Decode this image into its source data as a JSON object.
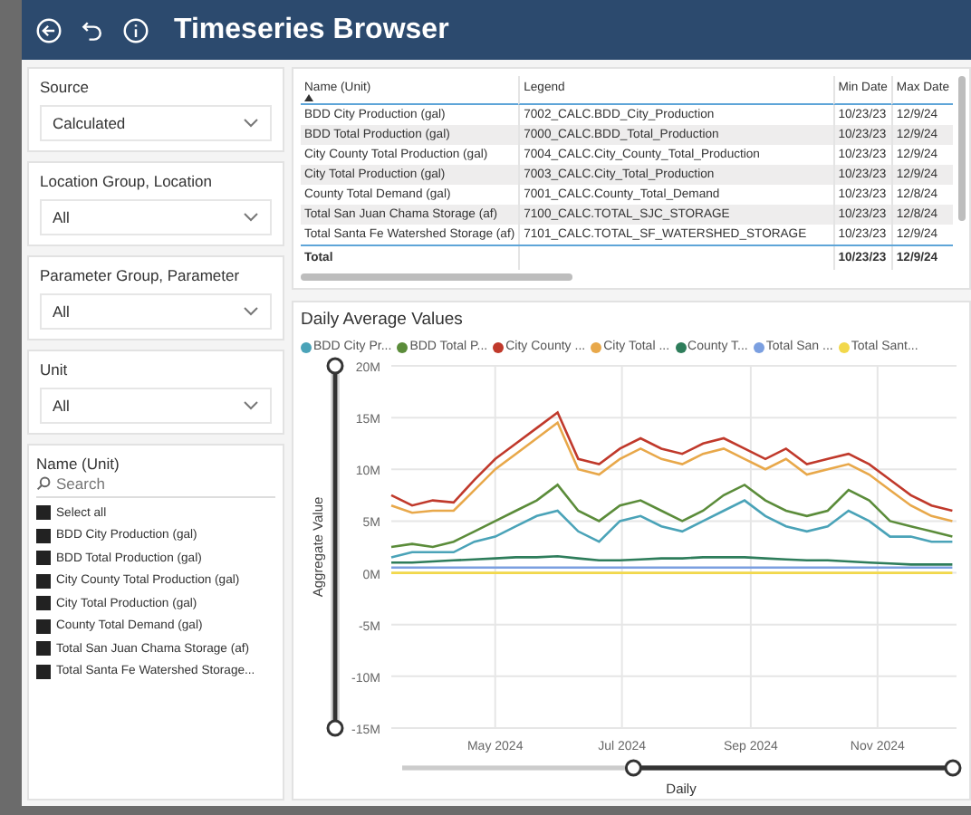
{
  "header": {
    "title": "Timeseries Browser"
  },
  "filters": [
    {
      "label": "Source",
      "value": "Calculated"
    },
    {
      "label": "Location Group, Location",
      "value": "All"
    },
    {
      "label": "Parameter Group, Parameter",
      "value": "All"
    },
    {
      "label": "Unit",
      "value": "All"
    }
  ],
  "name_filter": {
    "label": "Name (Unit)",
    "placeholder": "Search",
    "items": [
      {
        "label": "Select all",
        "checked": true
      },
      {
        "label": "BDD City Production (gal)",
        "checked": true
      },
      {
        "label": "BDD Total Production (gal)",
        "checked": true
      },
      {
        "label": "City County Total Production (gal)",
        "checked": true
      },
      {
        "label": "City Total Production (gal)",
        "checked": true
      },
      {
        "label": "County Total Demand (gal)",
        "checked": true
      },
      {
        "label": "Total San Juan Chama Storage (af)",
        "checked": true
      },
      {
        "label": "Total Santa Fe Watershed Storage...",
        "checked": true
      }
    ]
  },
  "table": {
    "columns": [
      {
        "label": "Name (Unit)",
        "sorted": true
      },
      {
        "label": "Legend",
        "sorted": false
      },
      {
        "label": "Min Date",
        "sorted": false
      },
      {
        "label": "Max Date",
        "sorted": false
      }
    ],
    "rows": [
      [
        "BDD City Production (gal)",
        "7002_CALC.BDD_City_Production",
        "10/23/23",
        "12/9/24"
      ],
      [
        "BDD Total Production (gal)",
        "7000_CALC.BDD_Total_Production",
        "10/23/23",
        "12/9/24"
      ],
      [
        "City County Total Production (gal)",
        "7004_CALC.City_County_Total_Production",
        "10/23/23",
        "12/9/24"
      ],
      [
        "City Total Production (gal)",
        "7003_CALC.City_Total_Production",
        "10/23/23",
        "12/9/24"
      ],
      [
        "County Total Demand (gal)",
        "7001_CALC.County_Total_Demand",
        "10/23/23",
        "12/8/24"
      ],
      [
        "Total San Juan Chama Storage (af)",
        "7100_CALC.TOTAL_SJC_STORAGE",
        "10/23/23",
        "12/8/24"
      ],
      [
        "Total Santa Fe Watershed Storage (af)",
        "7101_CALC.TOTAL_SF_WATERSHED_STORAGE",
        "10/23/23",
        "12/9/24"
      ]
    ],
    "total": {
      "label": "Total",
      "min_date": "10/23/23",
      "max_date": "12/9/24"
    }
  },
  "chart": {
    "title": "Daily Average Values",
    "y_slider": {
      "level": 1
    },
    "x_slider": {
      "level": 0.58,
      "label": "Daily"
    },
    "chart_data": {
      "type": "line",
      "ylabel": "Aggregate Value",
      "grid": true,
      "x": [
        "2024-03-12",
        "2024-03-22",
        "2024-04-01",
        "2024-04-11",
        "2024-04-21",
        "2024-05-01",
        "2024-05-11",
        "2024-05-21",
        "2024-05-31",
        "2024-06-10",
        "2024-06-20",
        "2024-06-30",
        "2024-07-10",
        "2024-07-20",
        "2024-07-30",
        "2024-08-09",
        "2024-08-19",
        "2024-08-29",
        "2024-09-08",
        "2024-09-18",
        "2024-09-28",
        "2024-10-08",
        "2024-10-18",
        "2024-10-28",
        "2024-11-07",
        "2024-11-17",
        "2024-11-27",
        "2024-12-07"
      ],
      "xlim": [
        "2024-03-12",
        "2024-12-09"
      ],
      "xticks": [
        {
          "value": "2024-05-01",
          "label": "May 2024"
        },
        {
          "value": "2024-07-01",
          "label": "Jul 2024"
        },
        {
          "value": "2024-09-01",
          "label": "Sep 2024"
        },
        {
          "value": "2024-11-01",
          "label": "Nov 2024"
        }
      ],
      "ylim": [
        -15,
        20
      ],
      "yticks": [
        {
          "value": 20,
          "label": "20M"
        },
        {
          "value": 15,
          "label": "15M"
        },
        {
          "value": 10,
          "label": "10M"
        },
        {
          "value": 5,
          "label": "5M"
        },
        {
          "value": 0,
          "label": "0M"
        },
        {
          "value": -5,
          "label": "-5M"
        },
        {
          "value": -10,
          "label": "-10M"
        },
        {
          "value": -15,
          "label": "-15M"
        }
      ],
      "series": [
        {
          "name": "BDD City Pr...",
          "color": "#4aa3b8",
          "values": [
            1.5,
            2,
            2,
            2,
            3,
            3.5,
            4.5,
            5.5,
            6,
            4,
            3,
            5,
            5.5,
            4.5,
            4,
            5,
            6,
            7,
            5.5,
            4.5,
            4,
            4.5,
            6,
            5,
            3.5,
            3.5,
            3,
            3
          ]
        },
        {
          "name": "BDD Total P...",
          "color": "#5b8c3a",
          "values": [
            2.5,
            2.8,
            2.5,
            3,
            4,
            5,
            6,
            7,
            8.5,
            6,
            5,
            6.5,
            7,
            6,
            5,
            6,
            7.5,
            8.5,
            7,
            6,
            5.5,
            6,
            8,
            7,
            5,
            4.5,
            4,
            3.5
          ]
        },
        {
          "name": "City County ...",
          "color": "#c0392b",
          "values": [
            7.5,
            6.5,
            7,
            6.8,
            9,
            11,
            12.5,
            14,
            15.5,
            11,
            10.5,
            12,
            13,
            12,
            11.5,
            12.5,
            13,
            12,
            11,
            12,
            10.5,
            11,
            11.5,
            10.5,
            9,
            7.5,
            6.5,
            6
          ]
        },
        {
          "name": "City Total ...",
          "color": "#e8a84a",
          "values": [
            6.5,
            5.8,
            6,
            6,
            8,
            10,
            11.5,
            13,
            14.5,
            10,
            9.5,
            11,
            12,
            11,
            10.5,
            11.5,
            12,
            11,
            10,
            11,
            9.5,
            10,
            10.5,
            9.5,
            8,
            6.5,
            5.5,
            5
          ]
        },
        {
          "name": "County T...",
          "color": "#2e7d5b",
          "values": [
            1,
            1,
            1.1,
            1.2,
            1.3,
            1.4,
            1.5,
            1.5,
            1.6,
            1.4,
            1.2,
            1.2,
            1.3,
            1.4,
            1.4,
            1.5,
            1.5,
            1.5,
            1.4,
            1.3,
            1.2,
            1.2,
            1.1,
            1,
            0.9,
            0.8,
            0.8,
            0.8
          ]
        },
        {
          "name": "Total San ...",
          "color": "#7b9fe0",
          "values": [
            0.5,
            0.5,
            0.5,
            0.5,
            0.5,
            0.5,
            0.5,
            0.5,
            0.5,
            0.5,
            0.5,
            0.5,
            0.5,
            0.5,
            0.5,
            0.5,
            0.5,
            0.5,
            0.5,
            0.5,
            0.5,
            0.5,
            0.5,
            0.5,
            0.5,
            0.5,
            0.5,
            0.5
          ]
        },
        {
          "name": "Total Sant...",
          "color": "#f2d84b",
          "values": [
            0,
            0,
            0,
            0,
            0,
            0,
            0,
            0,
            0,
            0,
            0,
            0,
            0,
            0,
            0,
            0,
            0,
            0,
            0,
            0,
            0,
            0,
            0,
            0,
            0,
            0,
            0,
            0
          ]
        }
      ]
    }
  }
}
